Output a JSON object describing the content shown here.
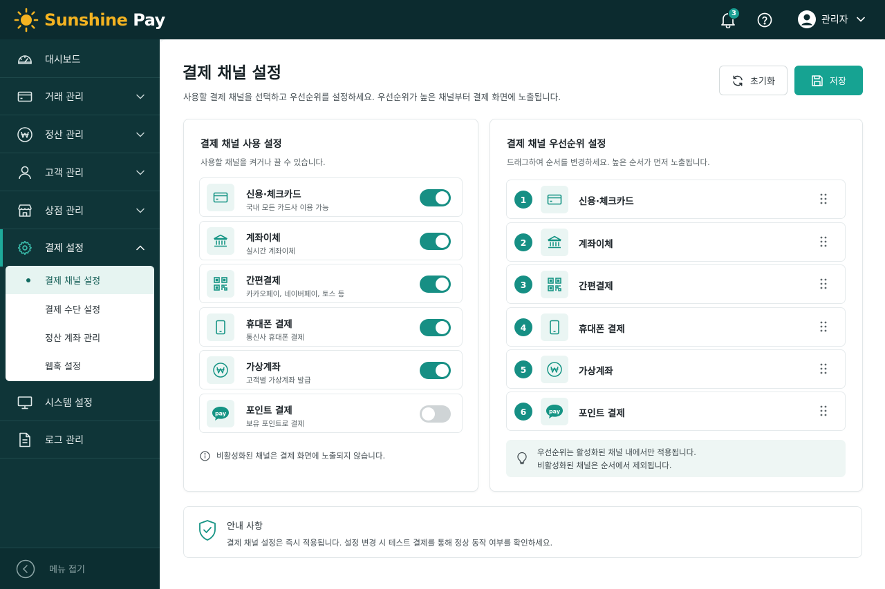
{
  "brand": {
    "name_part1": "Sunshine",
    "name_part2": "Pay",
    "accent": "#16a392",
    "brand_dark": "#0c2b2f",
    "logo_yellow": "#f4b321"
  },
  "topbar": {
    "notification_count": "3",
    "user_name": "관리자"
  },
  "sidebar": {
    "items": [
      {
        "label": "대시보드",
        "icon": "dashboard-icon"
      },
      {
        "label": "거래 관리",
        "icon": "card-icon"
      },
      {
        "label": "정산 관리",
        "icon": "won-icon"
      },
      {
        "label": "고객 관리",
        "icon": "user-icon"
      },
      {
        "label": "상점 관리",
        "icon": "store-icon"
      },
      {
        "label": "결제 설정",
        "icon": "gear-icon"
      },
      {
        "label": "시스템 설정",
        "icon": "monitor-icon"
      },
      {
        "label": "로그 관리",
        "icon": "document-icon"
      }
    ],
    "submenu": [
      {
        "label": "결제 채널 설정"
      },
      {
        "label": "결제 수단 설정"
      },
      {
        "label": "정산 계좌 관리"
      },
      {
        "label": "웹훅 설정"
      }
    ],
    "collapse_label": "메뉴 접기"
  },
  "page": {
    "title": "결제 채널 설정",
    "description": "사용할 결제 채널을 선택하고 우선순위를 설정하세요. 우선순위가 높은 채널부터 결제 화면에 노출됩니다.",
    "reset_label": "초기화",
    "save_label": "저장"
  },
  "channels_card": {
    "title": "결제 채널 사용 설정",
    "description": "사용할 채널을 켜거나 끌 수 있습니다.",
    "channels": [
      {
        "name": "신용·체크카드",
        "sub": "국내 모든 카드사 이용 가능",
        "enabled": true,
        "icon": "card-icon"
      },
      {
        "name": "계좌이체",
        "sub": "실시간 계좌이체",
        "enabled": true,
        "icon": "bank-icon"
      },
      {
        "name": "간편결제",
        "sub": "카카오페이, 네이버페이, 토스 등",
        "enabled": true,
        "icon": "qr-icon"
      },
      {
        "name": "휴대폰 결제",
        "sub": "통신사 휴대폰 결제",
        "enabled": true,
        "icon": "phone-icon"
      },
      {
        "name": "가상계좌",
        "sub": "고객별 가상계좌 발급",
        "enabled": true,
        "icon": "won-icon"
      },
      {
        "name": "포인트 결제",
        "sub": "보유 포인트로 결제",
        "enabled": false,
        "icon": "pay-icon"
      }
    ],
    "note": "비활성화된 채널은 결제 화면에 노출되지 않습니다."
  },
  "priority_card": {
    "title": "결제 채널 우선순위 설정",
    "description": "드래그하여 순서를 변경하세요. 높은 순서가 먼저 노출됩니다.",
    "items": [
      {
        "rank": "1",
        "name": "신용·체크카드"
      },
      {
        "rank": "2",
        "name": "계좌이체"
      },
      {
        "rank": "3",
        "name": "간편결제"
      },
      {
        "rank": "4",
        "name": "휴대폰 결제"
      },
      {
        "rank": "5",
        "name": "가상계좌"
      },
      {
        "rank": "6",
        "name": "포인트 결제"
      }
    ],
    "tip_line1": "우선순위는 활성화된 채널 내에서만 적용됩니다.",
    "tip_line2": "비활성화된 채널은 순서에서 제외됩니다."
  },
  "info": {
    "title": "안내 사항",
    "text": "결제 채널 설정은 즉시 적용됩니다. 설정 변경 시 테스트 결제를 통해 정상 동작 여부를 확인하세요."
  }
}
